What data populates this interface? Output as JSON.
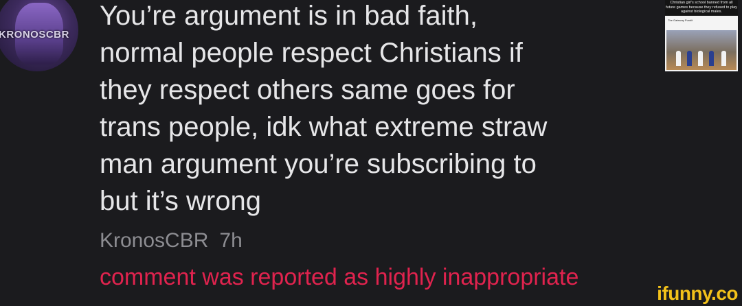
{
  "avatar": {
    "label": "KRONOSCBR"
  },
  "comment": {
    "text": "You’re argument is in bad faith,\nnormal people respect Christians if\nthey respect others same goes for\ntrans people, idk what extreme straw\nman argument you’re subscribing to\nbut it’s wrong",
    "author": "KronosCBR",
    "time": "7h",
    "report_notice": "comment was reported as highly inappropriate"
  },
  "thumbnail": {
    "headline": "Christian girl's school banned from all future games because they refused to play against biological males.",
    "source": "The Gateway Pundit"
  },
  "watermark": "ifunny.co",
  "colors": {
    "background": "#1b1b1e",
    "text": "#e6e6e8",
    "meta": "#8d8d92",
    "report": "#e0234e",
    "watermark": "#f3c21a"
  }
}
